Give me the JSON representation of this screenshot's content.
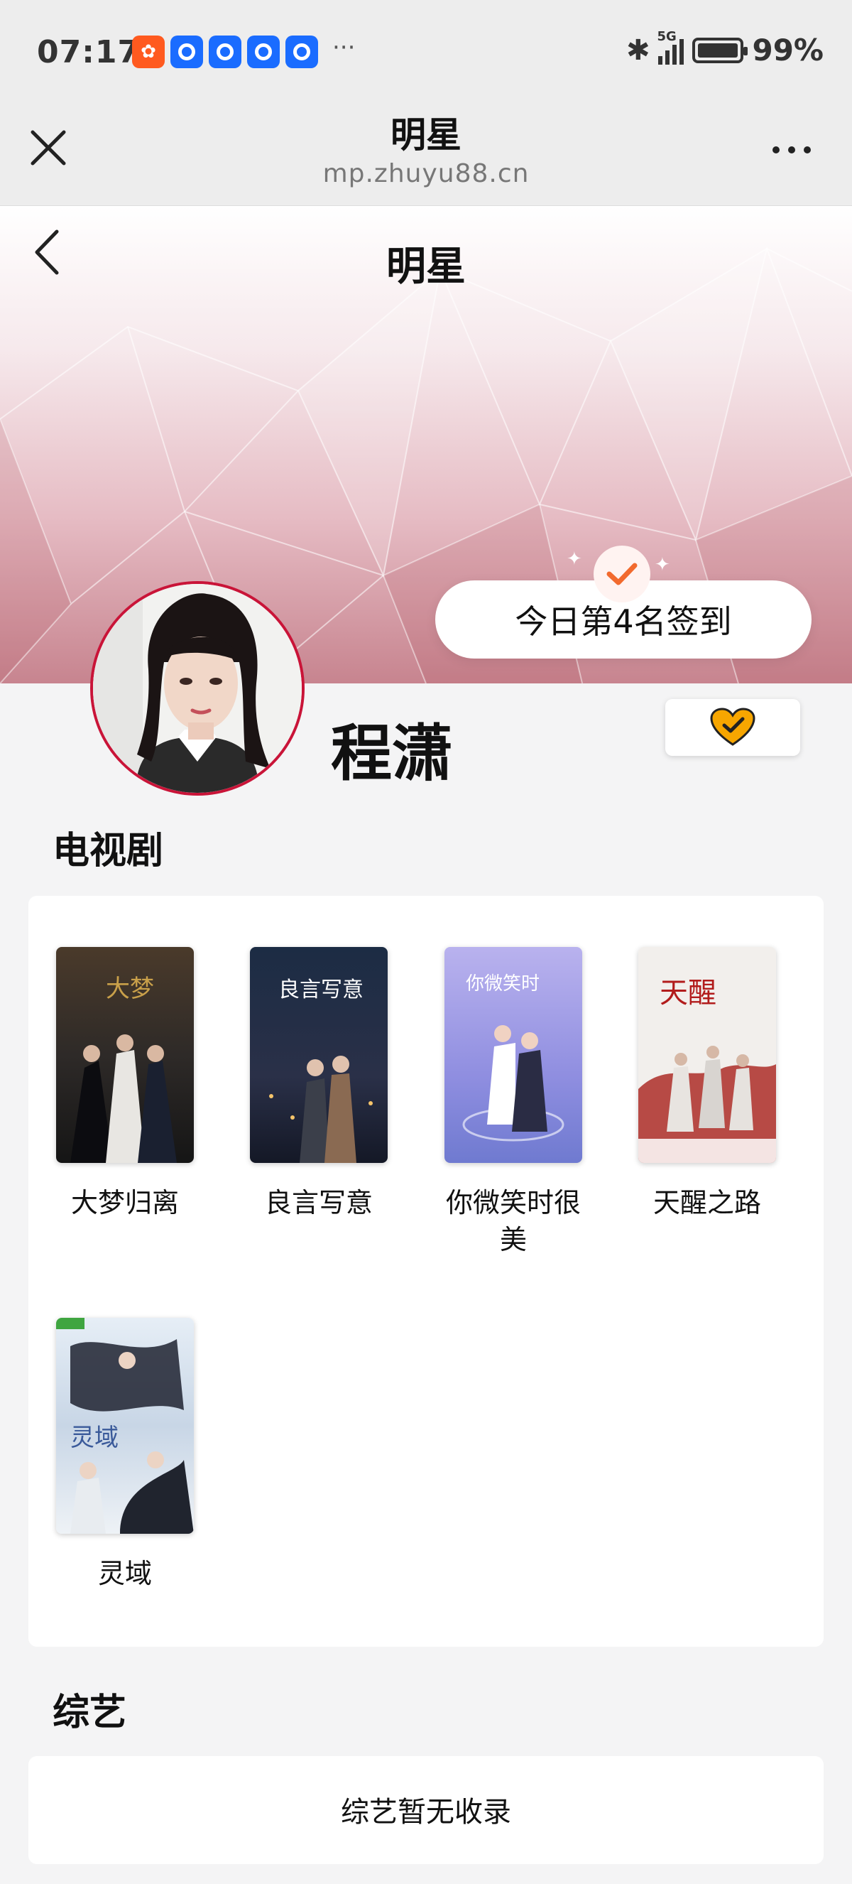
{
  "status_bar": {
    "time": "07:17",
    "network": "5G",
    "battery": "99%",
    "more_notifications": "···"
  },
  "titlebar": {
    "title": "明星",
    "url": "mp.zhuyu88.cn"
  },
  "header": {
    "title": "明星"
  },
  "checkin": {
    "label": "今日第4名签到"
  },
  "profile": {
    "name": "程潇"
  },
  "tv_section": {
    "title": "电视剧",
    "items": [
      {
        "title": "大梦归离"
      },
      {
        "title": "良言写意"
      },
      {
        "title": "你微笑时很美"
      },
      {
        "title": "天醒之路"
      },
      {
        "title": "灵域"
      }
    ]
  },
  "variety_section": {
    "title": "综艺",
    "empty_text": "综艺暂无收录"
  },
  "colors": {
    "accent_red": "#c91438",
    "checkin_orange": "#f26a2e",
    "heart_gold": "#f7a600"
  }
}
